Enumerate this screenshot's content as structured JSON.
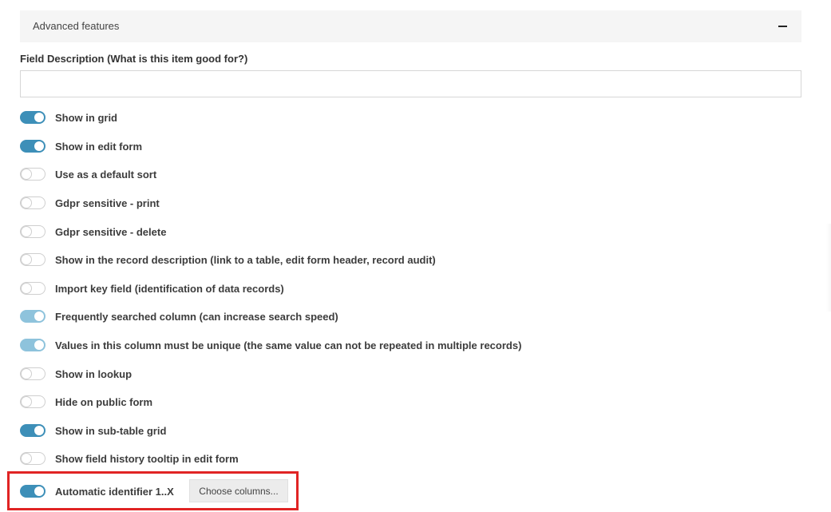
{
  "panel": {
    "title": "Advanced features"
  },
  "description": {
    "label": "Field Description (What is this item good for?)",
    "value": "",
    "placeholder": ""
  },
  "toggles": [
    {
      "label": "Show in grid",
      "on": true
    },
    {
      "label": "Show in edit form",
      "on": true
    },
    {
      "label": "Use as a default sort",
      "on": false
    },
    {
      "label": "Gdpr sensitive - print",
      "on": false
    },
    {
      "label": "Gdpr sensitive - delete",
      "on": false
    },
    {
      "label": "Show in the record description (link to a table, edit form header, record audit)",
      "on": false
    },
    {
      "label": "Import key field (identification of data records)",
      "on": false
    },
    {
      "label": "Frequently searched column (can increase search speed)",
      "on": true,
      "disabled_style": true
    },
    {
      "label": "Values in this column must be unique (the same value can not be repeated in multiple records)",
      "on": true,
      "disabled_style": true
    },
    {
      "label": "Show in lookup",
      "on": false
    },
    {
      "label": "Hide on public form",
      "on": false
    },
    {
      "label": "Show in sub-table grid",
      "on": true
    },
    {
      "label": "Show field history tooltip in edit form",
      "on": false
    },
    {
      "label": "Automatic identifier 1..X",
      "on": true
    }
  ],
  "choose_columns": {
    "label": "Choose columns..."
  },
  "colors": {
    "toggle_on": "#3d8fb8",
    "toggle_on_light": "#8ec3dc",
    "highlight": "#e02424"
  }
}
